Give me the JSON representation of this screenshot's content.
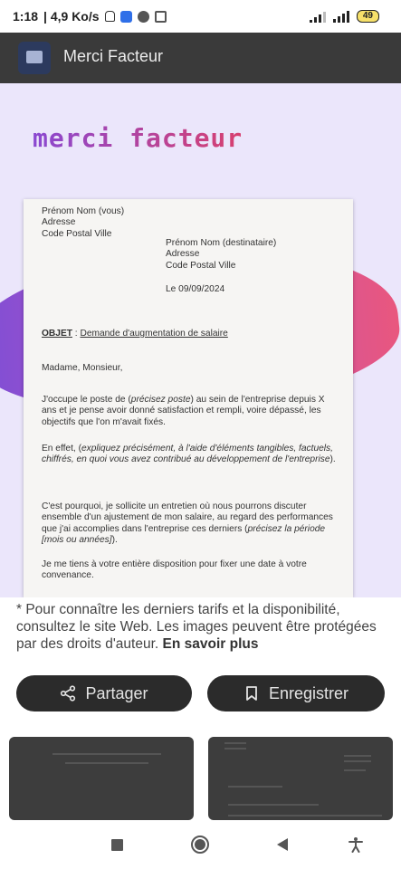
{
  "status_bar": {
    "time": "1:18",
    "network": "| 4,9 Ko/s",
    "battery": "49"
  },
  "app_bar": {
    "title": "Merci Facteur"
  },
  "preview": {
    "brand": "merci facteur",
    "letter": {
      "sender_name": "Prénom Nom (vous)",
      "sender_address": "Adresse",
      "sender_city": "Code Postal Ville",
      "recipient_name": "Prénom Nom (destinataire)",
      "recipient_address": "Adresse",
      "recipient_city": "Code Postal Ville",
      "date": "Le 09/09/2024",
      "object_label": "OBJET",
      "object_sep": " : ",
      "object_text": "Demande d'augmentation de salaire",
      "greeting": "Madame, Monsieur,",
      "p1_a": "J'occupe le poste de (",
      "p1_em": "précisez poste",
      "p1_b": ") au sein de l'entreprise depuis X ans et je pense avoir donné satisfaction et rempli, voire dépassé, les objectifs que l'on m'avait fixés.",
      "p2_a": "En effet, (",
      "p2_em": "expliquez précisément, à l'aide d'éléments tangibles, factuels, chiffrés, en quoi vous avez contribué au développement de l'entreprise",
      "p2_b": ").",
      "p3_a": "C'est pourquoi, je sollicite un entretien où nous pourrons discuter ensemble d'un ajustement de mon salaire, au regard des performances que j'ai accomplies dans l'entreprise ces derniers (",
      "p3_em": "précisez la période [mois ou années]",
      "p3_b": ").",
      "p4": "Je me tiens à votre entière disposition pour fixer une date à votre convenance."
    }
  },
  "caption": {
    "text": "* Pour connaître les derniers tarifs et la disponibilité, consultez le site Web. Les images peuvent être protégées par des droits d'auteur. ",
    "link": "En savoir plus"
  },
  "actions": {
    "share_label": "Partager",
    "save_label": "Enregistrer"
  },
  "icons": {
    "status": [
      "mute-bell-icon",
      "play-icon",
      "circle-slash-icon",
      "screenshot-icon",
      "wifi-icon",
      "signal-icon",
      "battery-icon"
    ],
    "app": "merci-facteur-logo",
    "buttons": [
      "share-icon",
      "bookmark-icon"
    ],
    "nav": [
      "recents-icon",
      "home-icon",
      "back-icon",
      "accessibility-icon"
    ]
  },
  "colors": {
    "overlay": "#3a3a3a",
    "brand_purple": "#8a48d1",
    "brand_pink": "#d8406f",
    "battery": "#f6e06a"
  }
}
